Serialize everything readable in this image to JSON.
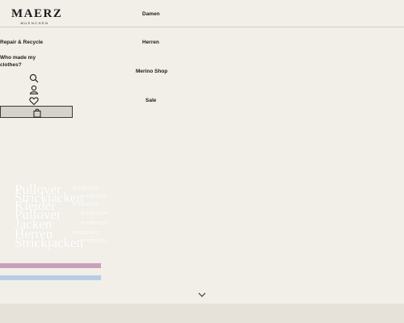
{
  "brand": {
    "name": "MAERZ",
    "sub": "MUENCHEN"
  },
  "nav_left": {
    "repair": "Repair & Recycle",
    "who_line1": "Who made my",
    "who_line2": "clothes?"
  },
  "nav_main": {
    "damen": "Damen",
    "herren": "Herren",
    "merino": "Merino Shop",
    "sale": "Sale"
  },
  "icons": [
    "search-icon",
    "account-icon",
    "wishlist-icon",
    "shopping-bag-icon",
    "chevron-down-icon"
  ],
  "hero_ticker": {
    "items": [
      {
        "word": "Pullover",
        "cta": "entdecken"
      },
      {
        "word": "Strickjacken",
        "cta": "entdecken"
      },
      {
        "word": "Kleider",
        "cta": "entdecken"
      },
      {
        "word": "Pullover",
        "cta": "entdecken"
      },
      {
        "word": "Jacken",
        "cta": "entdecken"
      },
      {
        "word": "Herren",
        "cta": "entdecken"
      },
      {
        "word": "Strickjacken",
        "cta": "entdecken"
      }
    ]
  },
  "colors": {
    "background": "#f1efe8",
    "bar_pink": "#c9a0b9",
    "bar_blue": "#b7cde2",
    "footer": "#e6e2d9",
    "button_fill": "#d6d2c9"
  }
}
